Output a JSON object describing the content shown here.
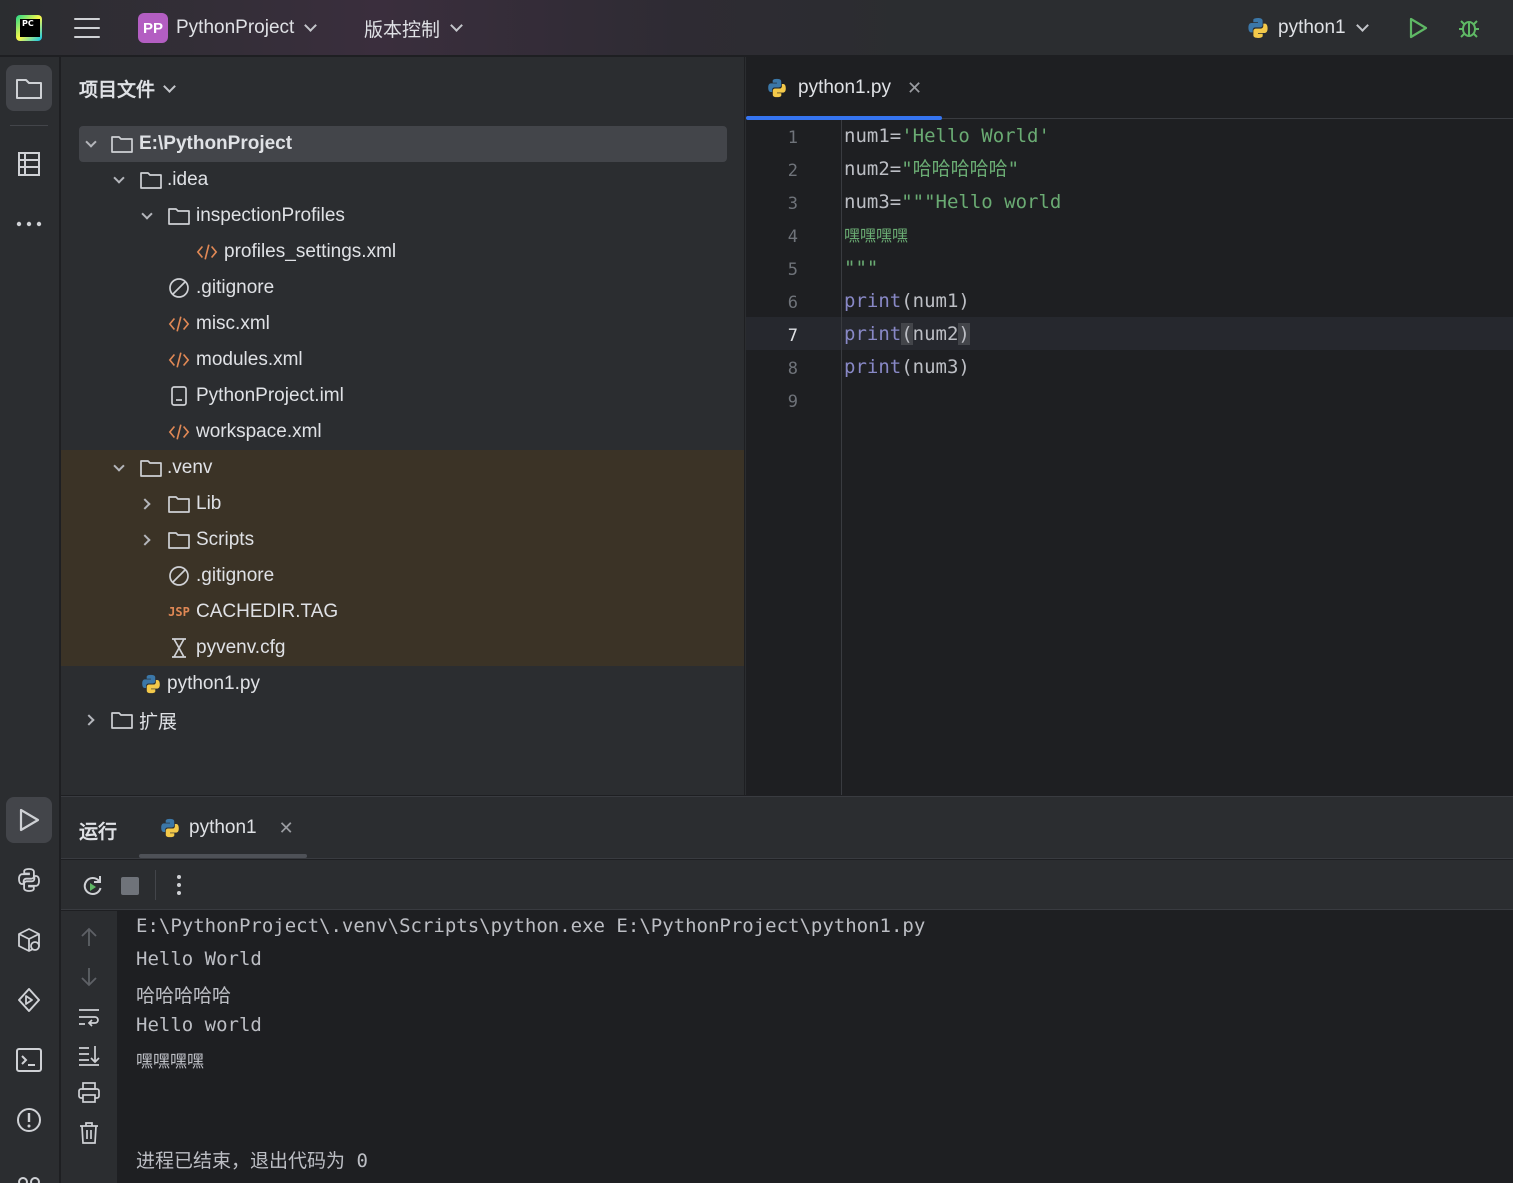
{
  "titlebar": {
    "project_badge": "PP",
    "project_name": "PythonProject",
    "vcs_label": "版本控制",
    "run_config": "python1"
  },
  "project_panel": {
    "header": "项目文件",
    "tree": [
      {
        "label": "E:\\PythonProject",
        "type": "folder",
        "expanded": true
      },
      {
        "label": ".idea",
        "type": "folder",
        "expanded": true
      },
      {
        "label": "inspectionProfiles",
        "type": "folder",
        "expanded": true
      },
      {
        "label": "profiles_settings.xml",
        "type": "xml"
      },
      {
        "label": ".gitignore",
        "type": "ignore"
      },
      {
        "label": "misc.xml",
        "type": "xml"
      },
      {
        "label": "modules.xml",
        "type": "xml"
      },
      {
        "label": "PythonProject.iml",
        "type": "iml"
      },
      {
        "label": "workspace.xml",
        "type": "xml"
      },
      {
        "label": ".venv",
        "type": "folder",
        "expanded": true
      },
      {
        "label": "Lib",
        "type": "folder",
        "expanded": false
      },
      {
        "label": "Scripts",
        "type": "folder",
        "expanded": false
      },
      {
        "label": ".gitignore",
        "type": "ignore"
      },
      {
        "label": "CACHEDIR.TAG",
        "type": "jsp",
        "icon_text": "JSP"
      },
      {
        "label": "pyvenv.cfg",
        "type": "cfg"
      },
      {
        "label": "python1.py",
        "type": "python"
      },
      {
        "label": "扩展",
        "type": "folder",
        "expanded": false
      }
    ]
  },
  "editor": {
    "tab_label": "python1.py",
    "current_line": 7,
    "line_numbers": [
      "1",
      "2",
      "3",
      "4",
      "5",
      "6",
      "7",
      "8",
      "9"
    ],
    "code": {
      "l1_var": "num1=",
      "l1_str": "'Hello World'",
      "l2_var": "num2=",
      "l2_str": "\"哈哈哈哈哈\"",
      "l3_var": "num3=",
      "l3_str": "\"\"\"Hello world",
      "l4_str": "嘿嘿嘿嘿",
      "l5_str": "\"\"\"",
      "l6_kw": "print",
      "l6_rest": "(num1)",
      "l7_kw": "print",
      "l7_open": "(",
      "l7_mid": "num2",
      "l7_close": ")",
      "l8_kw": "print",
      "l8_rest": "(num3)"
    }
  },
  "run_panel": {
    "title": "运行",
    "tab_label": "python1",
    "output": [
      "E:\\PythonProject\\.venv\\Scripts\\python.exe E:\\PythonProject\\python1.py",
      "Hello World",
      "哈哈哈哈哈",
      "Hello world",
      "嘿嘿嘿嘿",
      "进程已结束，退出代码为 0"
    ]
  },
  "colors": {
    "accent": "#3574f0",
    "run_green": "#5fb865",
    "string_green": "#6aab73",
    "keyword_purple": "#8888c6",
    "xml_orange": "#e08855",
    "venv_bg": "#3b3326"
  },
  "icons": [
    "pycharm-logo-icon",
    "hamburger-menu-icon",
    "run-icon",
    "debug-icon",
    "folder-icon",
    "structure-icon",
    "more-icon",
    "run-tool-icon",
    "python-console-icon",
    "python-packages-icon",
    "services-icon",
    "terminal-icon",
    "problems-icon",
    "git-icon",
    "rerun-icon",
    "stop-icon",
    "up-arrow-icon",
    "down-arrow-icon",
    "soft-wrap-icon",
    "scroll-to-end-icon",
    "print-icon",
    "trash-icon"
  ]
}
